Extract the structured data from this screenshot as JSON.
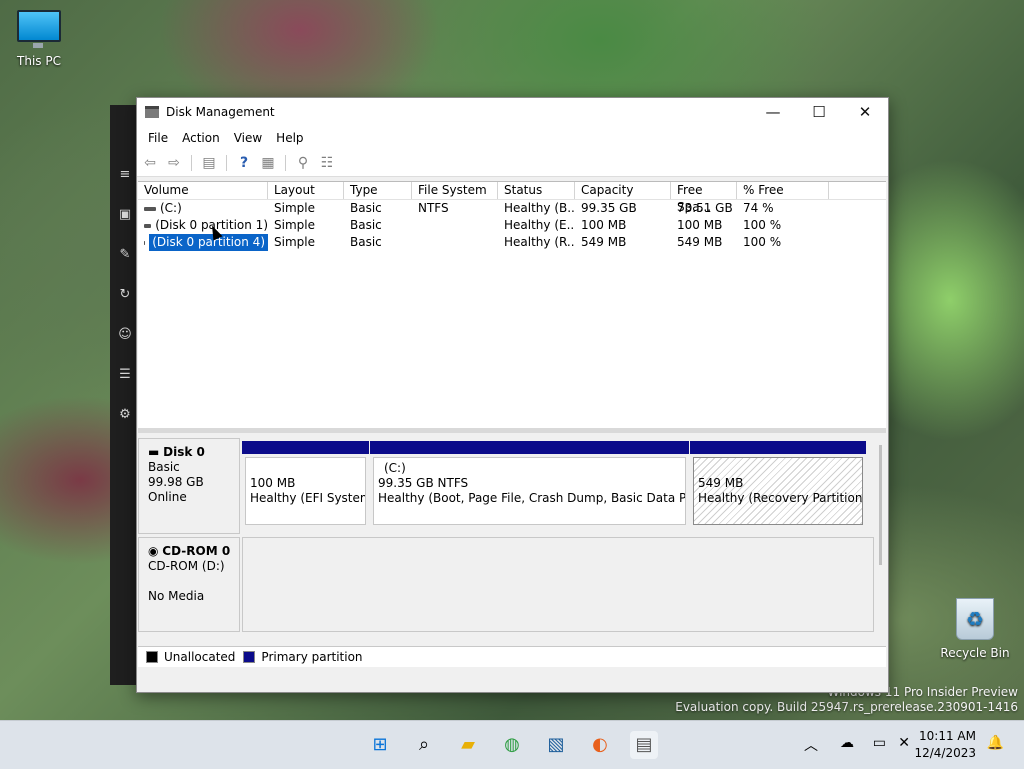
{
  "desktop": {
    "icons": [
      {
        "label": "This PC",
        "icon": "monitor-icon"
      },
      {
        "label": "Recycle Bin",
        "icon": "recycle-bin-icon"
      }
    ],
    "watermark": {
      "line1": "Windows 11 Pro Insider Preview",
      "line2": "Evaluation copy. Build 25947.rs_prerelease.230901-1416"
    }
  },
  "window": {
    "title": "Disk Management",
    "controls": {
      "minimize": "—",
      "maximize": "☐",
      "close": "✕"
    },
    "menu": [
      "File",
      "Action",
      "View",
      "Help"
    ],
    "toolbar": [
      "back-icon",
      "forward-icon",
      "console-tree-icon",
      "help-icon",
      "properties-icon",
      "rescan-icon",
      "settings-icon"
    ],
    "columns": [
      "Volume",
      "Layout",
      "Type",
      "File System",
      "Status",
      "Capacity",
      "Free Spa...",
      "% Free"
    ],
    "volumes": [
      {
        "volume": "(C:)",
        "layout": "Simple",
        "type": "Basic",
        "fs": "NTFS",
        "status": "Healthy (B...",
        "capacity": "99.35 GB",
        "free": "73.51 GB",
        "pct": "74 %"
      },
      {
        "volume": "(Disk 0 partition 1)",
        "layout": "Simple",
        "type": "Basic",
        "fs": "",
        "status": "Healthy (E...",
        "capacity": "100 MB",
        "free": "100 MB",
        "pct": "100 %"
      },
      {
        "volume": "(Disk 0 partition 4)",
        "layout": "Simple",
        "type": "Basic",
        "fs": "",
        "status": "Healthy (R...",
        "capacity": "549 MB",
        "free": "549 MB",
        "pct": "100 %"
      }
    ],
    "selected_volume_index": 2,
    "disks": [
      {
        "name": "Disk 0",
        "type": "Basic",
        "size": "99.98 GB",
        "state": "Online",
        "partitions": [
          {
            "title": "",
            "size": "100 MB",
            "status": "Healthy (EFI System P"
          },
          {
            "title": "(C:)",
            "size": "99.35 GB NTFS",
            "status": "Healthy (Boot, Page File, Crash Dump, Basic Data Partition"
          },
          {
            "title": "",
            "size": "549 MB",
            "status": "Healthy (Recovery Partition)"
          }
        ]
      },
      {
        "name": "CD-ROM 0",
        "drive": "CD-ROM (D:)",
        "media": "No Media"
      }
    ],
    "legend": [
      {
        "label": "Unallocated",
        "color": "#000000"
      },
      {
        "label": "Primary partition",
        "color": "#0b0b8a"
      }
    ]
  },
  "taskbar": {
    "apps": [
      "start-icon",
      "search-icon",
      "file-explorer-icon",
      "chrome-icon",
      "photos-icon",
      "firefox-icon",
      "disk-management-icon"
    ],
    "clock": {
      "time": "10:11 AM",
      "date": "12/4/2023"
    }
  }
}
